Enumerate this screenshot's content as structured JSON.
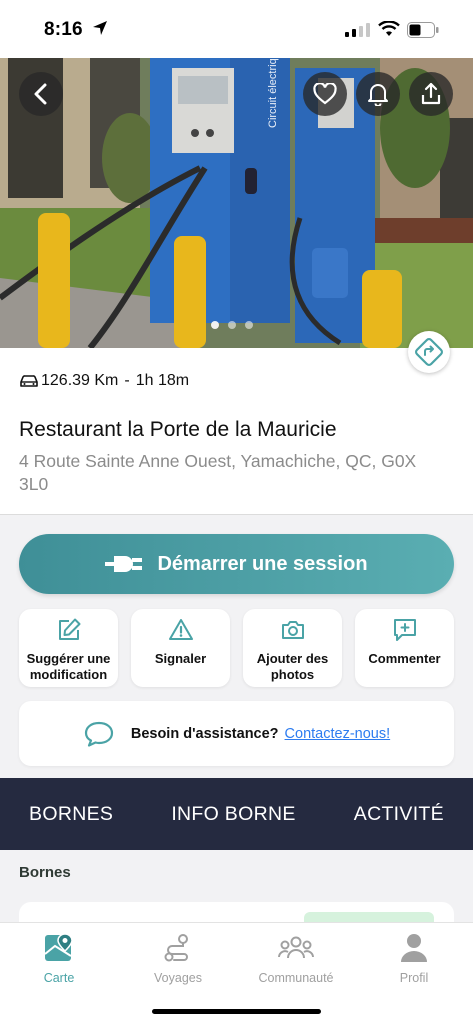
{
  "status_bar": {
    "time": "8:16"
  },
  "hero": {
    "carousel_count": 3,
    "carousel_active": 1,
    "photo_text": "Circuit électrique"
  },
  "trip": {
    "distance": "126.39 Km",
    "separator": "-",
    "duration": "1h 18m"
  },
  "station": {
    "name": "Restaurant la Porte de la Mauricie",
    "address": "4 Route Sainte Anne Ouest, Yamachiche, QC, G0X 3L0"
  },
  "session_button": {
    "label": "Démarrer une session"
  },
  "actions": [
    {
      "label": "Suggérer une modification",
      "icon": "edit-icon"
    },
    {
      "label": "Signaler",
      "icon": "warning-icon"
    },
    {
      "label": "Ajouter des photos",
      "icon": "camera-icon"
    },
    {
      "label": "Commenter",
      "icon": "comment-plus-icon"
    }
  ],
  "assistance": {
    "text": "Besoin d'assistance?",
    "link": "Contactez-nous!"
  },
  "tabs": [
    "BORNES",
    "INFO BORNE",
    "ACTIVITÉ"
  ],
  "section": {
    "title": "Bornes"
  },
  "bottom_nav": [
    {
      "label": "Carte",
      "icon": "map-icon",
      "active": true
    },
    {
      "label": "Voyages",
      "icon": "route-icon",
      "active": false
    },
    {
      "label": "Communauté",
      "icon": "community-icon",
      "active": false
    },
    {
      "label": "Profil",
      "icon": "profile-icon",
      "active": false
    }
  ],
  "colors": {
    "accent": "#4aa3a6",
    "tab_bar": "#252a40",
    "link": "#2d7cf0",
    "session_gradient_start": "#3f8f97",
    "session_gradient_end": "#5aaeb2"
  }
}
